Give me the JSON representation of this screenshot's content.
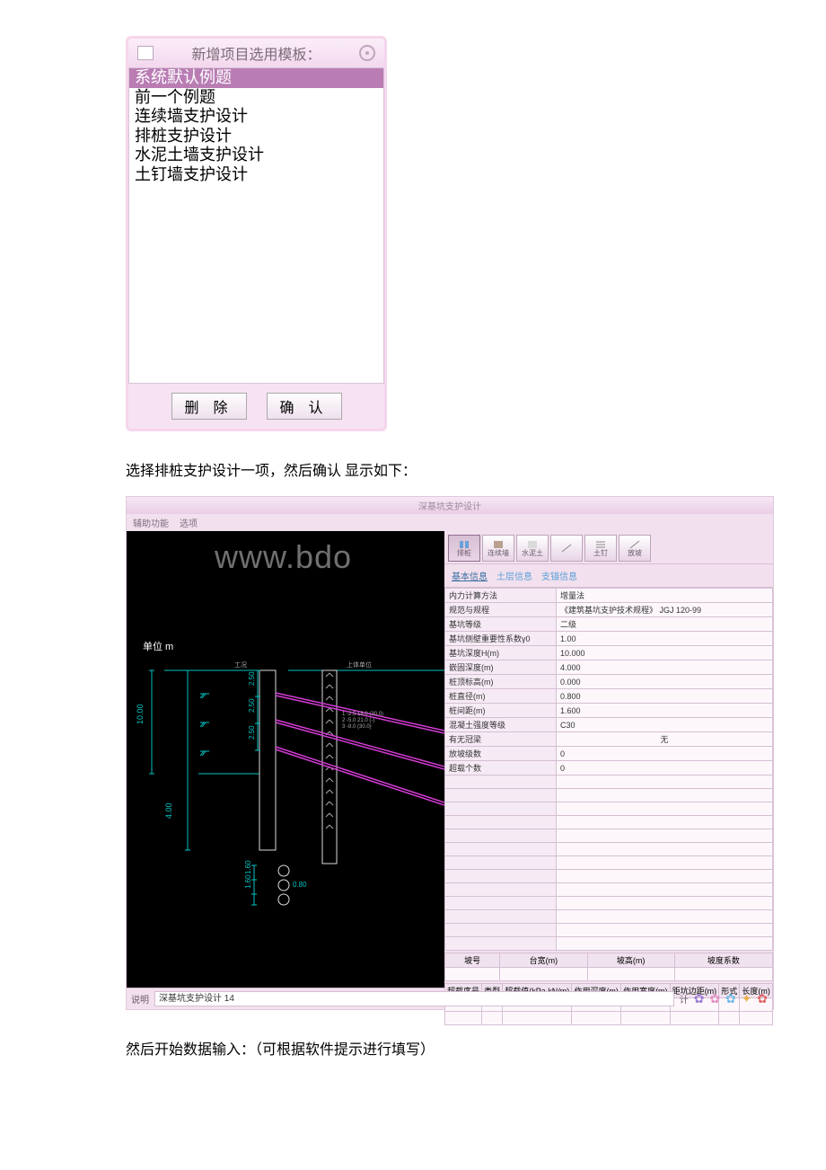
{
  "dialog1": {
    "title": "新增项目选用模板：",
    "items": [
      "系统默认例题",
      "前一个例题",
      "连续墙支护设计",
      "排桩支护设计",
      "水泥土墙支护设计",
      "土钉墙支护设计"
    ],
    "selected_index": 0,
    "buttons": {
      "delete": "删 除",
      "confirm": "确 认"
    }
  },
  "caption1": "选择排桩支护设计一项，然后确认 显示如下：",
  "app": {
    "title_center": "深基坑支护设计",
    "menu": [
      "辅助功能",
      "选项"
    ],
    "watermark": "www.bdo",
    "unit_label": "单位 m",
    "toolbuttons": [
      {
        "label": "排桩",
        "active": true
      },
      {
        "label": "连续墙"
      },
      {
        "label": "水泥土"
      },
      {
        "label": ""
      },
      {
        "label": "土钉"
      },
      {
        "label": "放坡"
      }
    ],
    "tabs": [
      {
        "label": "基本信息",
        "active": true
      },
      {
        "label": "土层信息"
      },
      {
        "label": "支锚信息"
      }
    ],
    "props": [
      {
        "k": "内力计算方法",
        "v": "增量法"
      },
      {
        "k": "规范与规程",
        "v": "《建筑基坑支护技术规程》 JGJ 120-99"
      },
      {
        "k": "基坑等级",
        "v": "二级"
      },
      {
        "k": "基坑侧壁重要性系数γ0",
        "v": "1.00"
      },
      {
        "k": "基坑深度H(m)",
        "v": "10.000"
      },
      {
        "k": "嵌固深度(m)",
        "v": "4.000"
      },
      {
        "k": "桩顶标高(m)",
        "v": "0.000"
      },
      {
        "k": "桩直径(m)",
        "v": "0.800"
      },
      {
        "k": "桩间距(m)",
        "v": "1.600"
      },
      {
        "k": "混凝土强度等级",
        "v": "C30"
      },
      {
        "k": "有无冠梁",
        "v": "无"
      },
      {
        "k": "放坡级数",
        "v": "0"
      },
      {
        "k": "超载个数",
        "v": "0"
      }
    ],
    "grid2_headers": [
      "坡号",
      "台宽(m)",
      "坡高(m)",
      "坡度系数"
    ],
    "grid3_headers": [
      "超载序号",
      "类型",
      "超载值(kPa,kN/m)",
      "作用深度(m)",
      "作用宽度(m)",
      "距坑边距(m)",
      "形式",
      "长度(m)"
    ],
    "status": {
      "label": "说明",
      "value": "深基坑支护设计 14",
      "calc": "计"
    },
    "dims": {
      "left_vertical": "10.00",
      "seg_top": "2.50",
      "seg_mid1": "2.50",
      "seg_mid2": "2.50",
      "embed": "4.00",
      "below1": "1.60",
      "below2": "1.60"
    }
  },
  "caption2": "然后开始数据输入：（可根据软件提示进行填写）"
}
